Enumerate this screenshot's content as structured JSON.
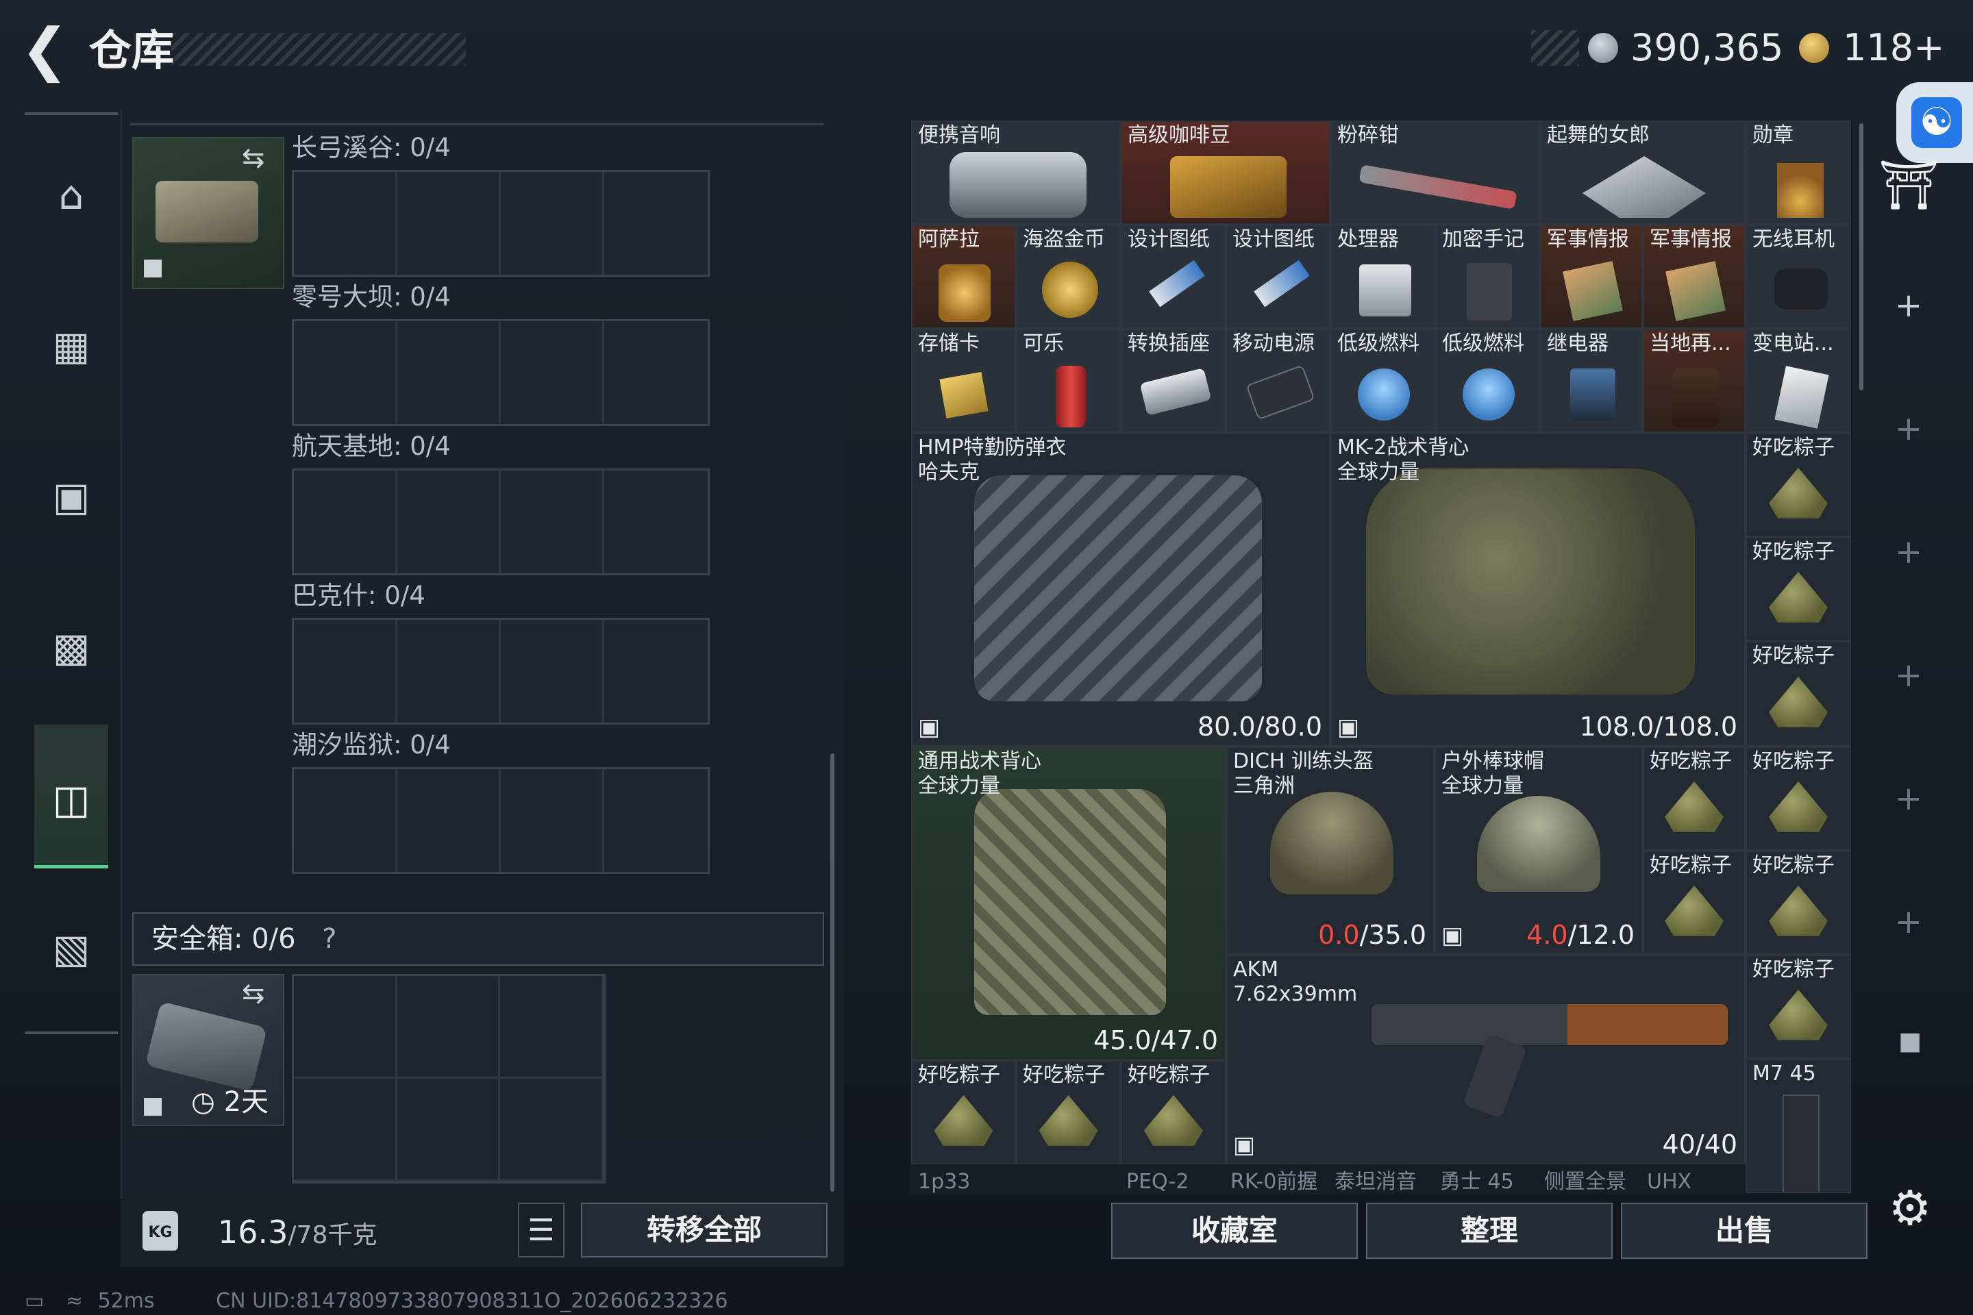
{
  "header": {
    "title": "仓库",
    "currency_silver": "390,365",
    "currency_gold": "118+"
  },
  "left_panel": {
    "maps": [
      {
        "label": "长弓溪谷: 0/4"
      },
      {
        "label": "零号大坝: 0/4"
      },
      {
        "label": "航天基地: 0/4"
      },
      {
        "label": "巴克什: 0/4"
      },
      {
        "label": "潮汐监狱: 0/4"
      }
    ],
    "safe_box": {
      "label": "安全箱: 0/6",
      "help": "?",
      "timer": "2天"
    },
    "weight": {
      "current": "16.3",
      "max": "/78千克"
    },
    "transfer_all": "转移全部"
  },
  "inventory": {
    "items": [
      {
        "name": "便携音响"
      },
      {
        "name": "高级咖啡豆"
      },
      {
        "name": "粉碎钳"
      },
      {
        "name": "起舞的女郎"
      },
      {
        "name": "勋章"
      },
      {
        "name": "阿萨拉"
      },
      {
        "name": "海盗金币"
      },
      {
        "name": "设计图纸"
      },
      {
        "name": "设计图纸"
      },
      {
        "name": "处理器"
      },
      {
        "name": "加密手记"
      },
      {
        "name": "军事情报"
      },
      {
        "name": "军事情报"
      },
      {
        "name": "无线耳机"
      },
      {
        "name": "存储卡"
      },
      {
        "name": "可乐"
      },
      {
        "name": "转换插座"
      },
      {
        "name": "移动电源"
      },
      {
        "name": "低级燃料"
      },
      {
        "name": "低级燃料"
      },
      {
        "name": "继电器"
      },
      {
        "name": "当地再..."
      },
      {
        "name": "变电站..."
      }
    ],
    "armor": [
      {
        "name": "HMP特勤防弹衣\n哈夫克",
        "durability": "80.0/80.0"
      },
      {
        "name": "MK-2战术背心\n全球力量",
        "durability": "108.0/108.0"
      },
      {
        "name": "通用战术背心\n全球力量",
        "durability": "45.0/47.0"
      }
    ],
    "helmets": [
      {
        "name": "DICH 训练头盔\n三角洲",
        "current": "0.0",
        "max": "/35.0"
      },
      {
        "name": "户外棒球帽\n全球力量",
        "current": "4.0",
        "max": "/12.0"
      }
    ],
    "weapon": {
      "name": "AKM\n7.62x39mm",
      "ammo": "40/40"
    },
    "zongzi": "好吃粽子",
    "mag": {
      "name": "M7 45"
    },
    "cut_row": [
      "1p33",
      "PEQ-2",
      "RK-0前握",
      "泰坦消音",
      "勇士 45",
      "侧置全景",
      "UHX"
    ]
  },
  "buttons": {
    "collection": "收藏室",
    "organize": "整理",
    "sell": "出售"
  },
  "status": {
    "ping": "52ms",
    "uid": "CN UID:8147809733807908311O_202606232326"
  },
  "colors": {
    "accent_green": "#58d18a",
    "damage_red": "#ff4b45",
    "access_blue": "#2478e8"
  }
}
